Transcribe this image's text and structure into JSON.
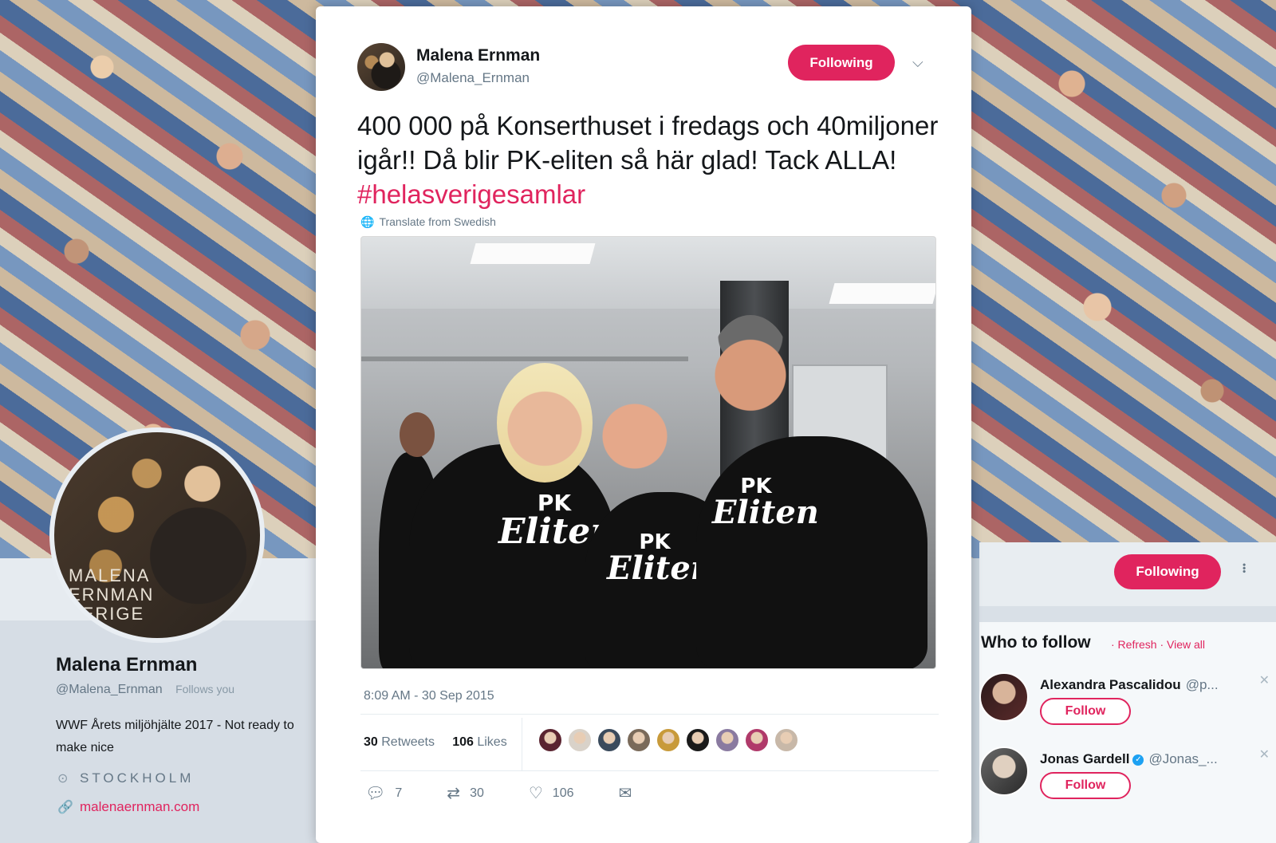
{
  "tweet": {
    "author_name": "Malena Ernman",
    "author_handle": "@Malena_Ernman",
    "follow_state": "Following",
    "text_main": "400 000 på Konserthuset i fredags och 40miljoner igår!! Då blir PK-eliten så här glad! Tack ALLA!",
    "hashtag": "#helasverigesamlar",
    "translate_label": "Translate from Swedish",
    "timestamp": "8:09 AM - 30 Sep 2015",
    "retweets_count": "30",
    "retweets_label": "Retweets",
    "likes_count": "106",
    "likes_label": "Likes",
    "reply_count": "7",
    "retweet_action_count": "30",
    "like_action_count": "106",
    "photo": {
      "shirt_line1": "PK",
      "shirt_line2": "Eliten"
    },
    "liker_colors": [
      "#5a2430",
      "#d9d2c9",
      "#3a4a5c",
      "#7a6a5a",
      "#c89a3a",
      "#1a1a1a",
      "#8a7aa0",
      "#b03a6a",
      "#c8b8a8"
    ]
  },
  "profile": {
    "name": "Malena Ernman",
    "handle": "@Malena_Ernman",
    "follows_you": "Follows you",
    "bio": "WWF Årets miljöhjälte 2017 - Not ready to make nice",
    "location": "STOCKHOLM",
    "link": "malenaernman.com",
    "avatar_text_1": "MALENA",
    "avatar_text_2": "ERNMAN",
    "avatar_text_3": "VERIGE"
  },
  "sidebar": {
    "following_label": "Following",
    "who_to_follow_title": "Who to follow",
    "refresh_label": "· Refresh",
    "view_all_label": "· View all",
    "suggestions": [
      {
        "name": "Alexandra Pascalidou",
        "handle": "@p...",
        "follow_label": "Follow"
      },
      {
        "name": "Jonas Gardell",
        "handle": "@Jonas_...",
        "follow_label": "Follow"
      }
    ]
  },
  "colors": {
    "accent": "#e0245e",
    "text": "#14171a",
    "muted": "#657786"
  }
}
